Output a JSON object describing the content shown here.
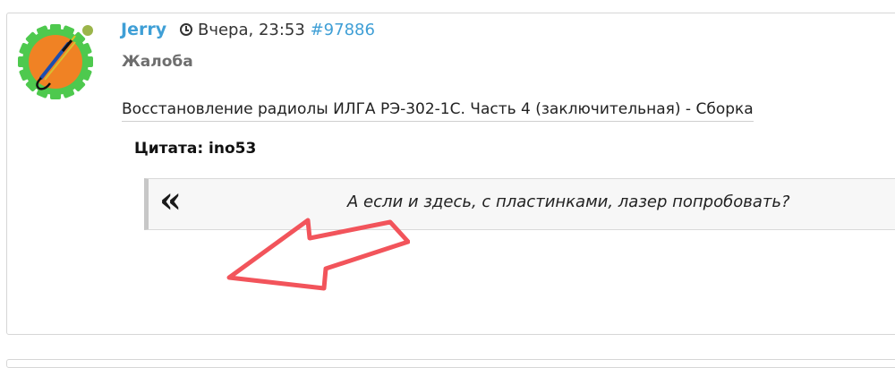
{
  "post": {
    "author": "Jerry",
    "time": "Вчера, 23:53",
    "post_id": "#97886",
    "subtitle": "Жалоба",
    "topic_title": "Восстановление радиолы ИЛГА РЭ-302-1С. Часть 4 (заключительная) - Сборка",
    "online_status_color": "#9bb54a",
    "accent_color": "#3f9fd6"
  },
  "quote": {
    "header": "Цитата: ino53",
    "mark": "«",
    "text": "А если и здесь, с пластинками, лазер попробовать?"
  },
  "icons": {
    "avatar": "soldering-iron-gear-avatar",
    "clock": "clock-icon"
  },
  "annotation": {
    "arrow_color": "#f2545b"
  }
}
